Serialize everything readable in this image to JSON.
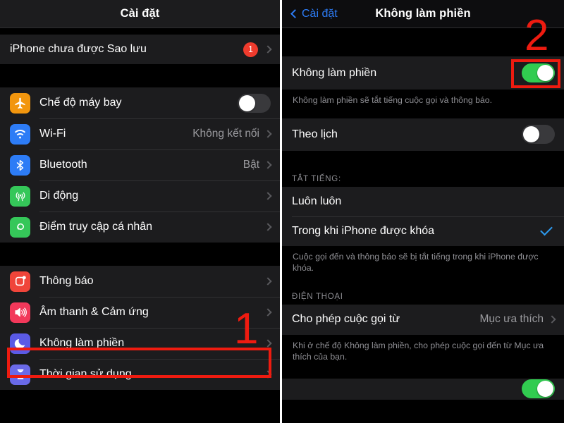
{
  "left_panel": {
    "navbar": {
      "title": "Cài đặt"
    },
    "backup_row": {
      "label": "iPhone chưa được Sao lưu",
      "badge": "1"
    },
    "group_connectivity": [
      {
        "label": "Chế độ máy bay",
        "icon": "airplane-icon",
        "icon_color": "#f2960e",
        "control": "toggle",
        "toggle_on": false
      },
      {
        "label": "Wi-Fi",
        "icon": "wifi-icon",
        "icon_color": "#2d7cf6",
        "control": "chevron",
        "value": "Không kết nối"
      },
      {
        "label": "Bluetooth",
        "icon": "bluetooth-icon",
        "icon_color": "#2d7cf6",
        "control": "chevron",
        "value": "Bật"
      },
      {
        "label": "Di động",
        "icon": "cellular-icon",
        "icon_color": "#35c759",
        "control": "chevron",
        "value": ""
      },
      {
        "label": "Điểm truy cập cá nhân",
        "icon": "hotspot-icon",
        "icon_color": "#35c759",
        "control": "chevron",
        "value": ""
      }
    ],
    "group_notifications": [
      {
        "label": "Thông báo",
        "icon": "notifications-icon",
        "icon_color": "#f0453a",
        "control": "chevron",
        "value": ""
      },
      {
        "label": "Âm thanh & Cảm ứng",
        "icon": "sounds-icon",
        "icon_color": "#f2385a",
        "control": "chevron",
        "value": ""
      },
      {
        "label": "Không làm phiền",
        "icon": "moon-icon",
        "icon_color": "#5a5ae6",
        "control": "chevron",
        "value": ""
      },
      {
        "label": "Thời gian sử dụng",
        "icon": "hourglass-icon",
        "icon_color": "#5a5ae6",
        "control": "chevron",
        "value": ""
      }
    ]
  },
  "right_panel": {
    "navbar": {
      "back_label": "Cài đặt",
      "title": "Không làm phiền"
    },
    "dnd_row": {
      "label": "Không làm phiền",
      "toggle_on": true
    },
    "dnd_footnote": "Không làm phiền sẽ tắt tiếng cuộc gọi và thông báo.",
    "schedule_row": {
      "label": "Theo lịch",
      "toggle_on": false
    },
    "silence_header": "TẮT TIẾNG:",
    "silence_options": [
      {
        "label": "Luôn luôn",
        "selected": false
      },
      {
        "label": "Trong khi iPhone được khóa",
        "selected": true
      }
    ],
    "silence_footnote": "Cuộc gọi đến và thông báo sẽ bị tắt tiếng trong khi iPhone được khóa.",
    "phone_header": "ĐIỆN THOẠI",
    "allow_calls_row": {
      "label": "Cho phép cuộc gọi từ",
      "value": "Mục ưa thích"
    },
    "allow_calls_footnote": "Khi ở chế độ Không làm phiền, cho phép cuộc gọi đến từ Mục ưa thích của bạn.",
    "partial_row": {
      "label": "",
      "toggle_on": true
    }
  },
  "annotations": [
    {
      "name": "step-1-number",
      "text": "1"
    },
    {
      "name": "step-2-number",
      "text": "2"
    }
  ],
  "colors": {
    "accent_red": "#ee1b10",
    "accent_blue": "#2d7cf6",
    "toggle_on_green": "#31cc50",
    "row_bg": "#1c1c1e",
    "page_bg": "#000000"
  }
}
